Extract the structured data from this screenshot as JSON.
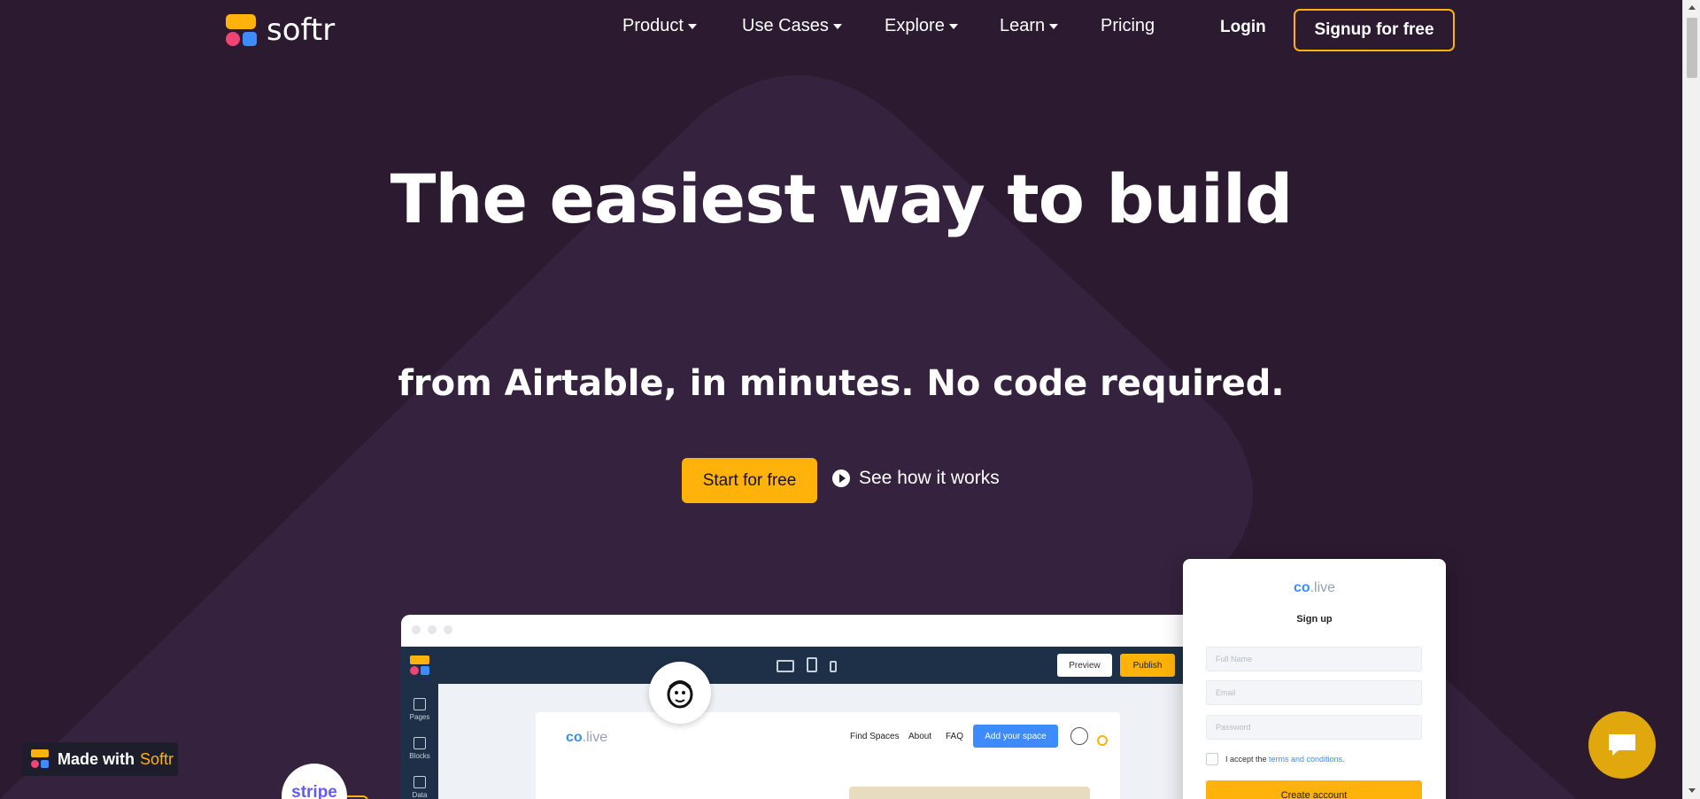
{
  "brand": {
    "name": "softr"
  },
  "nav": {
    "items": [
      {
        "label": "Product",
        "dropdown": true
      },
      {
        "label": "Use Cases",
        "dropdown": true
      },
      {
        "label": "Explore",
        "dropdown": true
      },
      {
        "label": "Learn",
        "dropdown": true
      },
      {
        "label": "Pricing",
        "dropdown": false
      }
    ],
    "login": "Login",
    "signup": "Signup for free"
  },
  "hero": {
    "headline": "The easiest way to build",
    "subheadline": "from Airtable, in minutes. No code required.",
    "cta_primary": "Start for free",
    "cta_secondary": "See how it works"
  },
  "mockup": {
    "editor": {
      "preview": "Preview",
      "publish": "Publish"
    },
    "rail": [
      "Pages",
      "Blocks",
      "Data"
    ],
    "site": {
      "logo_prefix": "co",
      "logo_suffix": ".live",
      "nav": [
        "Find Spaces",
        "About",
        "FAQ"
      ],
      "cta": "Add your space"
    },
    "integrations": {
      "stripe": "stripe"
    },
    "signup_card": {
      "logo_prefix": "co",
      "logo_suffix": ".live",
      "title": "Sign up",
      "fields": [
        "Full Name",
        "Email",
        "Password"
      ],
      "terms_prefix": "I accept the ",
      "terms_link": "terms and conditions.",
      "button": "Create account"
    }
  },
  "badge": {
    "prefix": "Made with",
    "brand": "Softr"
  },
  "colors": {
    "background": "#2b1a30",
    "accent": "#ffb20a",
    "blue": "#3d8bfd",
    "pink": "#f04475"
  }
}
